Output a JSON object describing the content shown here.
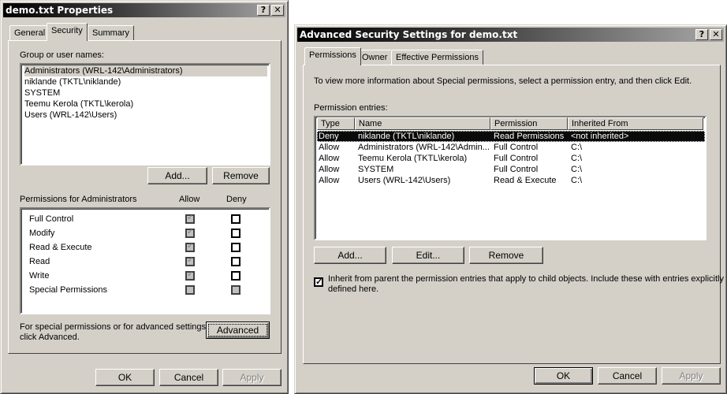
{
  "props": {
    "title": "demo.txt Properties",
    "help": "?",
    "close": "✕",
    "tabs": [
      "General",
      "Security",
      "Summary"
    ],
    "group_label": "Group or user names:",
    "users": [
      "Administrators (WRL-142\\Administrators)",
      "niklande (TKTL\\niklande)",
      "SYSTEM",
      "Teemu Kerola (TKTL\\kerola)",
      "Users (WRL-142\\Users)"
    ],
    "add": "Add...",
    "remove": "Remove",
    "perm_label": "Permissions for Administrators",
    "allow": "Allow",
    "deny": "Deny",
    "perms": [
      {
        "name": "Full Control",
        "allow": "inherited-checked",
        "deny": "unchecked"
      },
      {
        "name": "Modify",
        "allow": "inherited-checked",
        "deny": "unchecked"
      },
      {
        "name": "Read & Execute",
        "allow": "inherited-checked",
        "deny": "unchecked"
      },
      {
        "name": "Read",
        "allow": "inherited-checked",
        "deny": "unchecked"
      },
      {
        "name": "Write",
        "allow": "inherited-checked",
        "deny": "unchecked"
      },
      {
        "name": "Special Permissions",
        "allow": "disabled",
        "deny": "disabled"
      }
    ],
    "advanced_text_1": "For special permissions or for advanced settings,",
    "advanced_text_2": "click Advanced.",
    "advanced": "Advanced",
    "ok": "OK",
    "cancel": "Cancel",
    "apply": "Apply"
  },
  "adv": {
    "title": "Advanced Security Settings for demo.txt",
    "help": "?",
    "close": "✕",
    "tabs": [
      "Permissions",
      "Owner",
      "Effective Permissions"
    ],
    "info": "To view more information about Special permissions, select a permission entry, and then click Edit.",
    "entries_label": "Permission entries:",
    "columns": [
      "Type",
      "Name",
      "Permission",
      "Inherited From"
    ],
    "entries": [
      {
        "type": "Deny",
        "name": "niklande (TKTL\\niklande)",
        "permission": "Read Permissions",
        "inherited": "<not inherited>",
        "selected": true
      },
      {
        "type": "Allow",
        "name": "Administrators (WRL-142\\Admin...",
        "permission": "Full Control",
        "inherited": "C:\\"
      },
      {
        "type": "Allow",
        "name": "Teemu Kerola (TKTL\\kerola)",
        "permission": "Full Control",
        "inherited": "C:\\"
      },
      {
        "type": "Allow",
        "name": "SYSTEM",
        "permission": "Full Control",
        "inherited": "C:\\"
      },
      {
        "type": "Allow",
        "name": "Users (WRL-142\\Users)",
        "permission": "Read & Execute",
        "inherited": "C:\\"
      }
    ],
    "add": "Add...",
    "edit": "Edit...",
    "remove": "Remove",
    "inherit_checked": true,
    "inherit_text_1": "Inherit from parent the permission entries that apply to child objects. Include these with entries explicitly",
    "inherit_text_2": "defined here.",
    "ok": "OK",
    "cancel": "Cancel",
    "apply": "Apply"
  }
}
